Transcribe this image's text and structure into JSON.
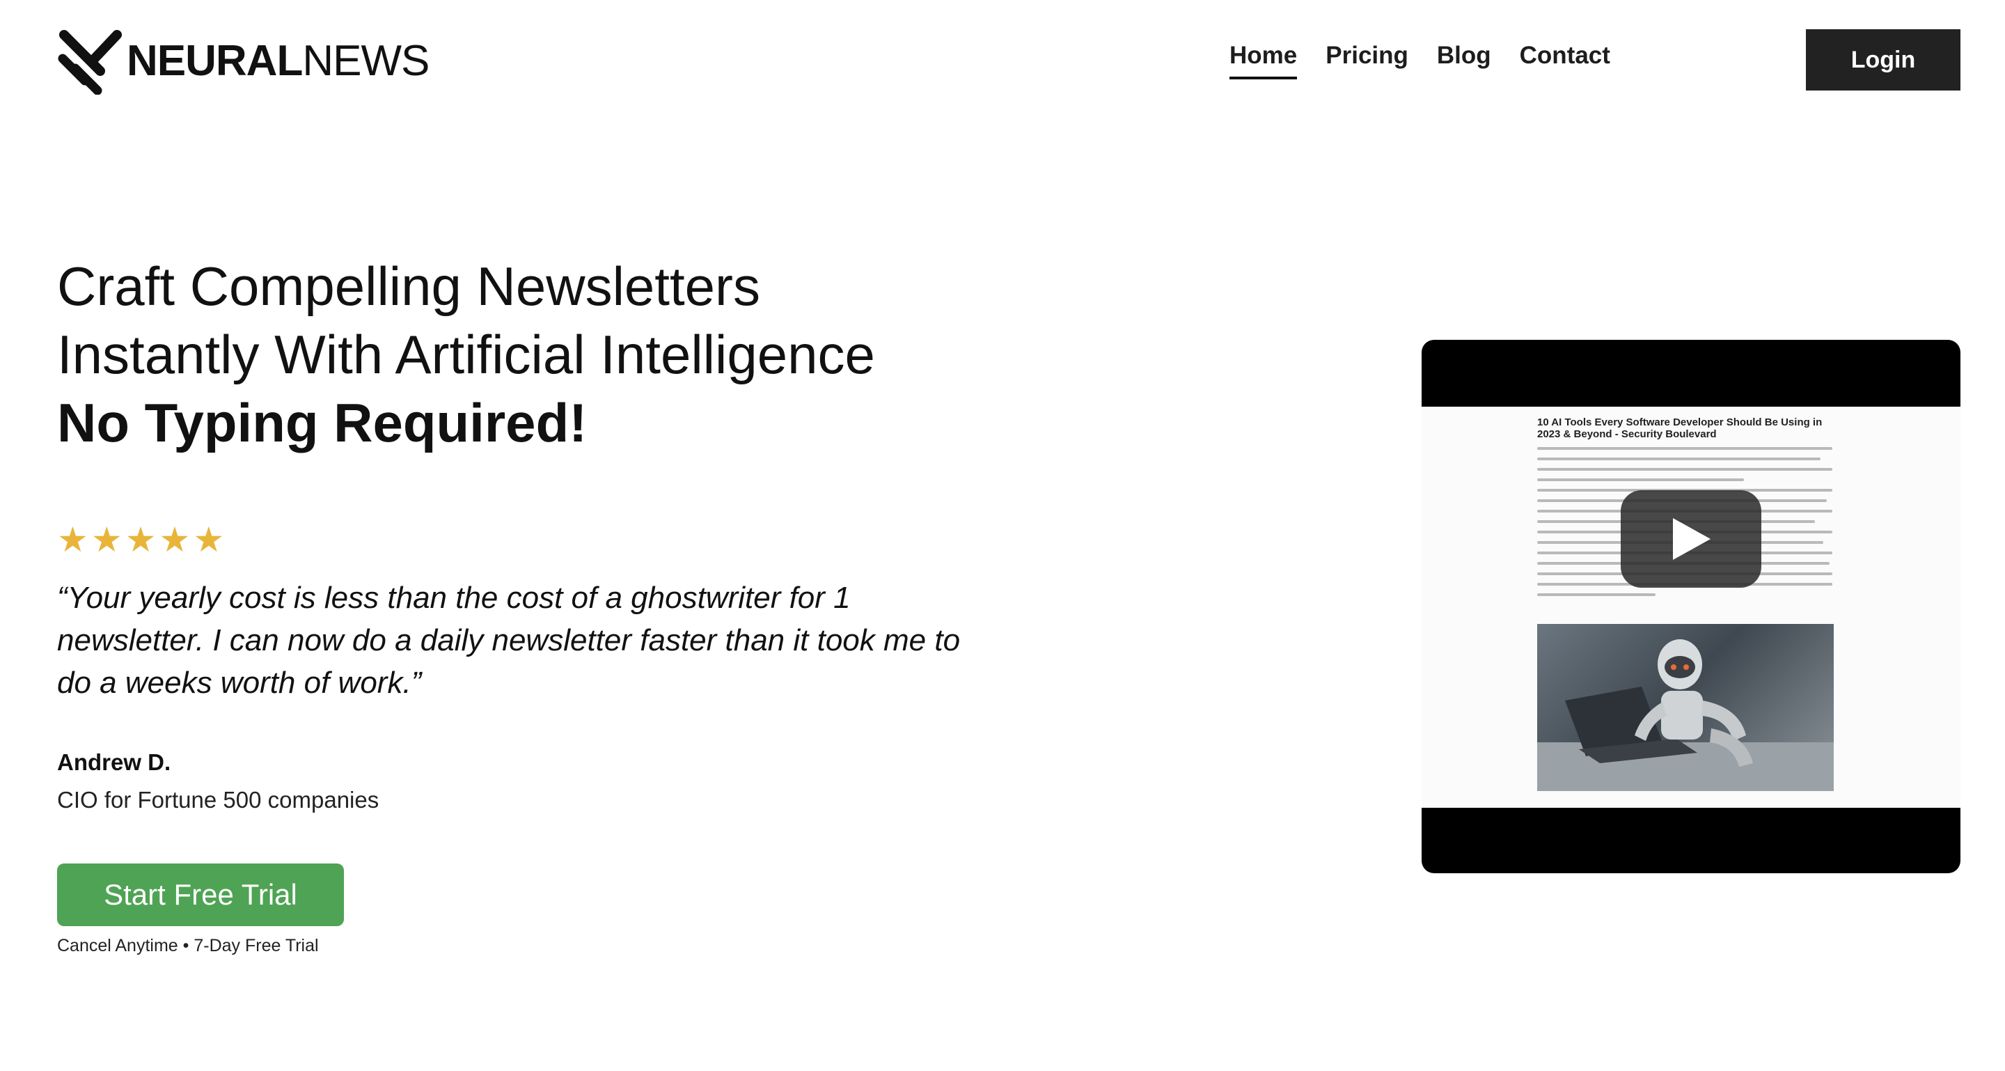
{
  "header": {
    "logo": {
      "text_bold": "NEURAL",
      "text_light": "NEWS"
    },
    "nav": [
      {
        "label": "Home",
        "active": true
      },
      {
        "label": "Pricing",
        "active": false
      },
      {
        "label": "Blog",
        "active": false
      },
      {
        "label": "Contact",
        "active": false
      }
    ],
    "login_label": "Login"
  },
  "hero": {
    "headline_line1": "Craft Compelling Newsletters",
    "headline_line2": "Instantly With Artificial Intelligence",
    "headline_line3": "No Typing Required!",
    "rating_stars": 5,
    "quote": "“Your yearly cost is less than the cost of a ghostwriter for 1 newsletter. I can now do a daily newsletter faster than it took me to do a weeks worth of work.”",
    "author_name": "Andrew D.",
    "author_title": "CIO for Fortune 500 companies",
    "cta_label": "Start Free Trial",
    "cta_note": "Cancel Anytime • 7-Day Free Trial"
  },
  "video": {
    "doc_title": "10 AI Tools Every Software Developer Should Be Using in 2023 & Beyond - Security Boulevard"
  },
  "colors": {
    "accent_green": "#4fa354",
    "login_bg": "#222222",
    "star": "#e8b53a"
  }
}
